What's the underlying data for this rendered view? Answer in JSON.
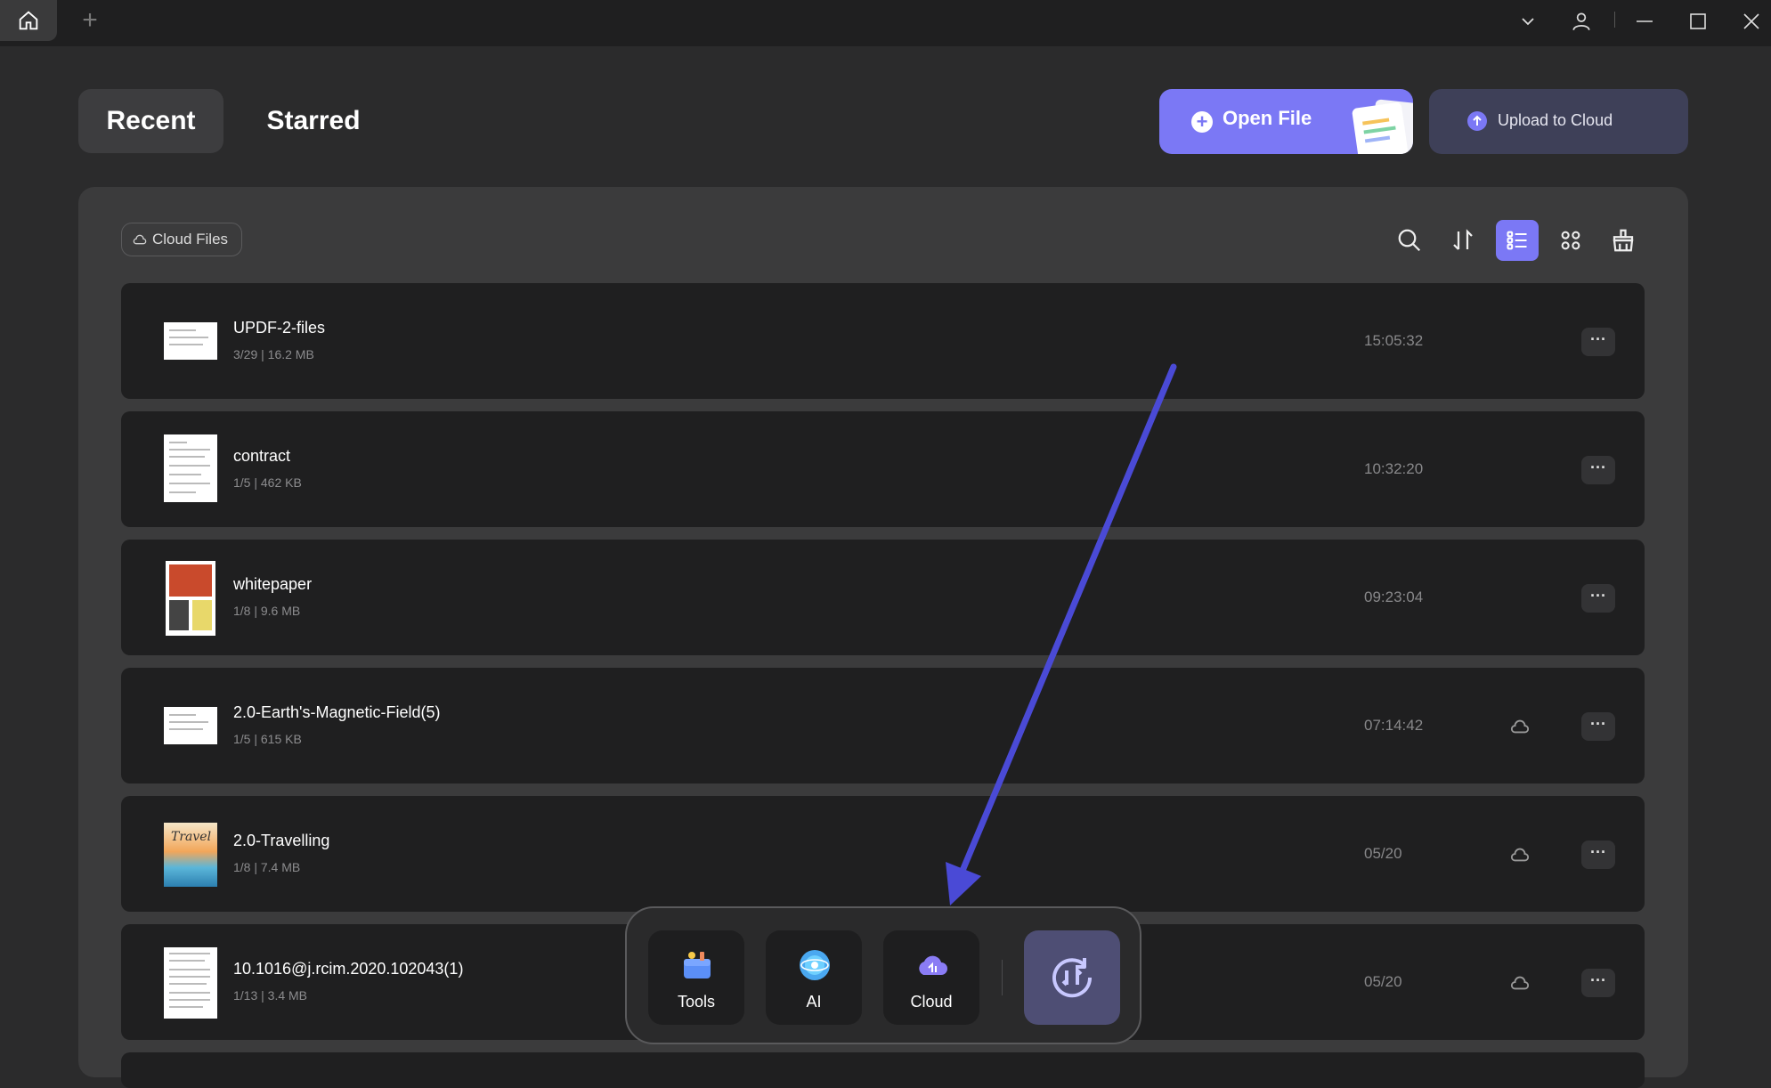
{
  "titlebar": {
    "home_icon": "home-icon",
    "new_tab_icon": "plus-icon",
    "controls": [
      "chevron-down-icon",
      "user-icon",
      "minimize-icon",
      "maximize-icon",
      "close-icon"
    ]
  },
  "tabs": [
    {
      "label": "Recent",
      "active": true
    },
    {
      "label": "Starred",
      "active": false
    }
  ],
  "actions": {
    "open_file": "Open File",
    "upload_to_cloud": "Upload to Cloud"
  },
  "filter_chip": "Cloud Files",
  "toolbar": {
    "tools": [
      "search-icon",
      "sort-icon",
      "list-view-icon",
      "grid-view-icon",
      "clean-icon"
    ],
    "active_view": "list"
  },
  "files": [
    {
      "name": "UPDF-2-files",
      "meta": "3/29 | 16.2 MB",
      "time": "15:05:32",
      "cloud": false
    },
    {
      "name": "contract",
      "meta": "1/5 | 462 KB",
      "time": "10:32:20",
      "cloud": false
    },
    {
      "name": "whitepaper",
      "meta": "1/8 | 9.6 MB",
      "time": "09:23:04",
      "cloud": false
    },
    {
      "name": "2.0-Earth's-Magnetic-Field(5)",
      "meta": "1/5 | 615 KB",
      "time": "07:14:42",
      "cloud": true
    },
    {
      "name": "2.0-Travelling",
      "meta": "1/8 | 7.4 MB",
      "time": "05/20",
      "cloud": true
    },
    {
      "name": "10.1016@j.rcim.2020.102043(1)",
      "meta": "1/13 | 3.4 MB",
      "time": "05/20",
      "cloud": true
    }
  ],
  "more_label": "···",
  "dock": {
    "items": [
      {
        "label": "Tools",
        "icon": "toolbox-icon"
      },
      {
        "label": "AI",
        "icon": "ai-icon"
      },
      {
        "label": "Cloud",
        "icon": "cloud-icon"
      }
    ],
    "sync_icon": "sync-icon"
  },
  "colors": {
    "accent": "#7b78f5",
    "annotation_arrow": "#4a4ad6",
    "background": "#2b2b2c",
    "row": "#1f1f20"
  }
}
